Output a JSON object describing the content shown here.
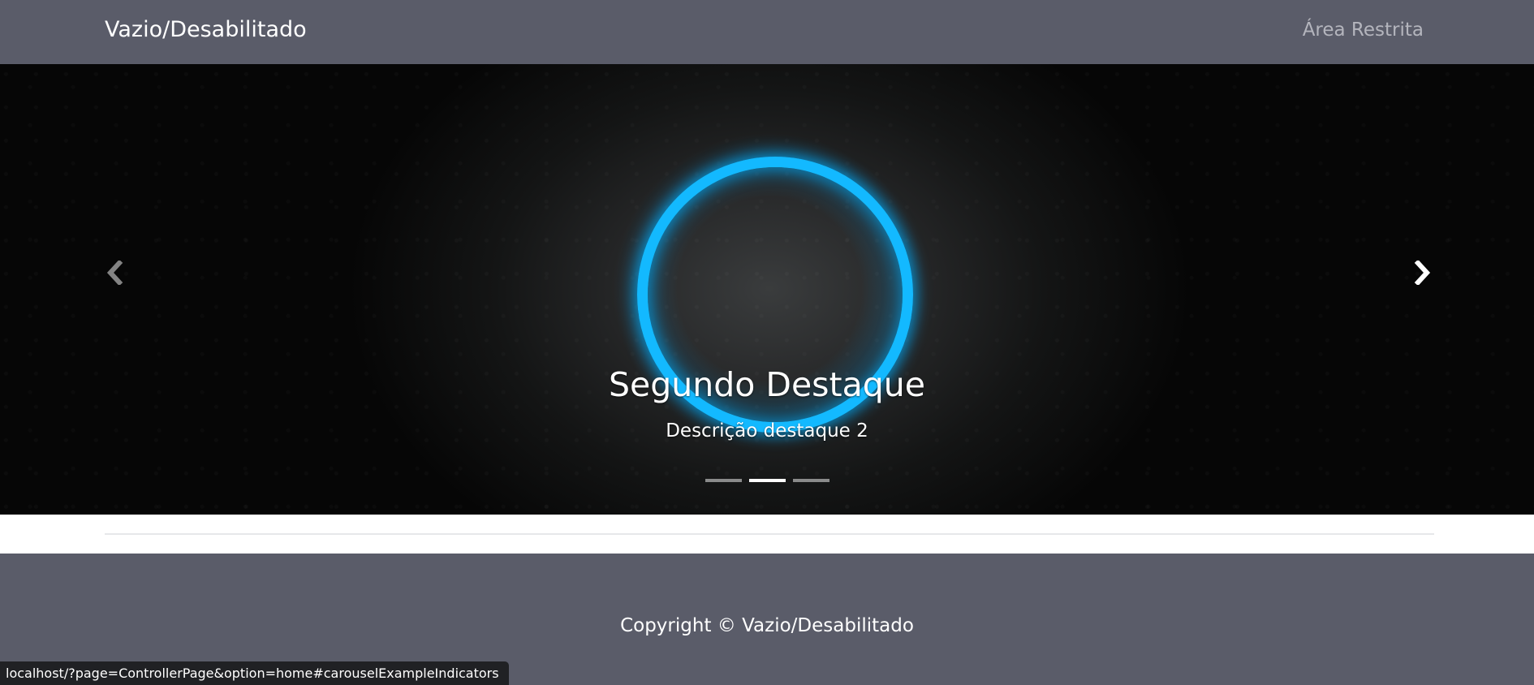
{
  "navbar": {
    "brand": "Vazio/Desabilitado",
    "link_label": "Área Restrita"
  },
  "carousel": {
    "title": "Segundo Destaque",
    "description": "Descrição destaque 2",
    "indicators": [
      {
        "active": false
      },
      {
        "active": true
      },
      {
        "active": false
      }
    ],
    "accent_color": "#13b9ff",
    "prev_icon": "chevron-left-icon",
    "next_icon": "chevron-right-icon"
  },
  "footer": {
    "copyright": "Copyright © Vazio/Desabilitado"
  },
  "status_bar": {
    "url": "localhost/?page=ControllerPage&option=home#carouselExampleIndicators"
  },
  "colors": {
    "navbar_bg": "#5a5c69",
    "footer_bg": "#5a5c69",
    "nav_link": "#b4b5bd"
  }
}
